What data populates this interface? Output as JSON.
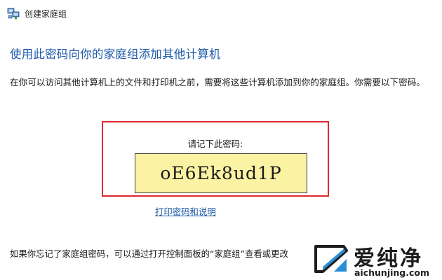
{
  "window": {
    "title": "创建家庭组",
    "icon": "homegroup-icon"
  },
  "content": {
    "heading": "使用此密码向你的家庭组添加其他计算机",
    "description": "在你可以访问其他计算机上的文件和打印机之前，需要将这些计算机添加到你的家庭组。你需要以下密码。",
    "password_prompt": "请记下此密码:",
    "password": "oE6Ek8ud1P",
    "print_link": "打印密码和说明",
    "footer_note": "如果你忘记了家庭组密码，可以通过打开控制面板的“家庭组”查看或更改"
  },
  "watermark": {
    "brand": "爱纯净",
    "domain": "aichunjing.com"
  },
  "colors": {
    "heading": "#1e5aa8",
    "link": "#1e5aa8",
    "highlight_frame": "#e0282f",
    "password_box_bg": "#fbf3a3"
  }
}
